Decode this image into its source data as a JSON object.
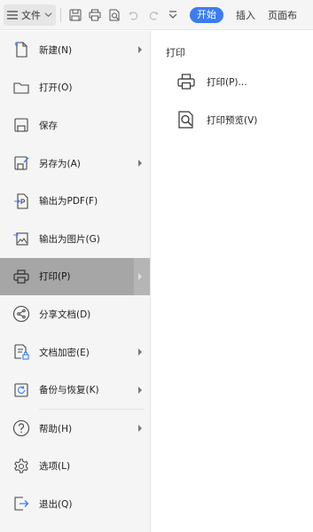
{
  "toolbar": {
    "file_label": "文件",
    "tab_start": "开始",
    "tab_insert": "插入",
    "tab_page": "页面布"
  },
  "menu": {
    "items": [
      {
        "label": "新建(N)",
        "icon": "new-file-icon",
        "has_arrow": true
      },
      {
        "label": "打开(O)",
        "icon": "open-folder-icon",
        "has_arrow": false
      },
      {
        "label": "保存",
        "icon": "save-icon",
        "has_arrow": false
      },
      {
        "label": "另存为(A)",
        "icon": "save-as-icon",
        "has_arrow": true
      },
      {
        "label": "输出为PDF(F)",
        "icon": "export-pdf-icon",
        "has_arrow": false
      },
      {
        "label": "输出为图片(G)",
        "icon": "export-image-icon",
        "has_arrow": false
      },
      {
        "label": "打印(P)",
        "icon": "print-icon",
        "has_arrow": true,
        "active": true
      },
      {
        "label": "分享文档(D)",
        "icon": "share-icon",
        "has_arrow": false
      },
      {
        "label": "文档加密(E)",
        "icon": "encrypt-icon",
        "has_arrow": true
      },
      {
        "label": "备份与恢复(K)",
        "icon": "backup-icon",
        "has_arrow": true
      },
      {
        "label": "帮助(H)",
        "icon": "help-icon",
        "has_arrow": true
      },
      {
        "label": "选项(L)",
        "icon": "settings-icon",
        "has_arrow": false
      },
      {
        "label": "退出(Q)",
        "icon": "exit-icon",
        "has_arrow": false
      }
    ]
  },
  "panel": {
    "title": "打印",
    "print_label": "打印(P)...",
    "preview_label": "打印预览(V)"
  },
  "colors": {
    "accent": "#3b7cf4",
    "active_item": "#a6a6a6",
    "menu_bg": "#f5f5f5"
  }
}
